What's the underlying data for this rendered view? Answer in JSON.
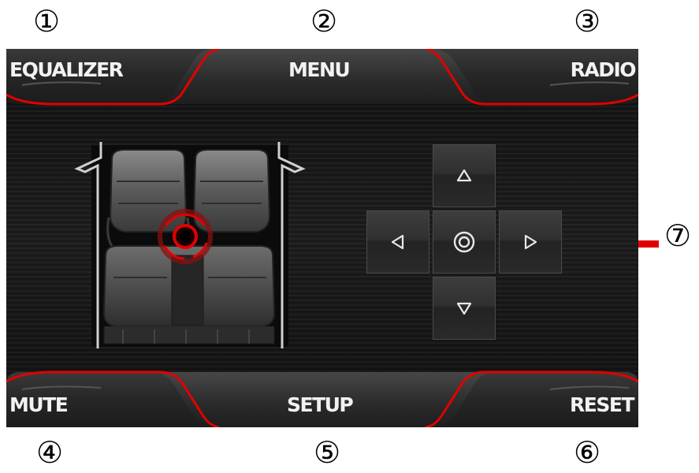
{
  "callouts": [
    "①",
    "②",
    "③",
    "④",
    "⑤",
    "⑥",
    "⑦"
  ],
  "top_bar": {
    "left_label": "EQUALIZER",
    "center_label": "MENU",
    "right_label": "RADIO"
  },
  "bottom_bar": {
    "left_label": "MUTE",
    "center_label": "SETUP",
    "right_label": "RESET"
  },
  "seat_balance": {
    "indicator_icon": "sound-focus-ring-icon"
  },
  "dpad": {
    "up_icon": "triangle-up-icon",
    "down_icon": "triangle-down-icon",
    "left_icon": "triangle-left-icon",
    "right_icon": "triangle-right-icon",
    "center_icon": "target-center-icon"
  },
  "colors": {
    "accent": "#e30000",
    "bar_background": "#2a2a2a",
    "label": "#f2f2f2"
  }
}
